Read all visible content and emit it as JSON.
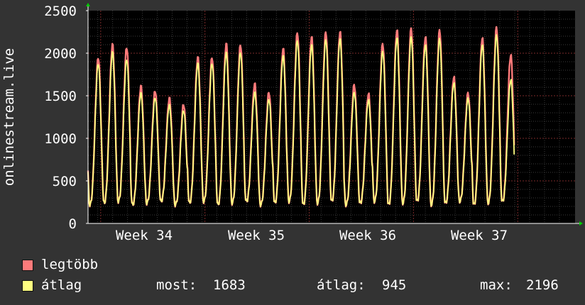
{
  "chart_data": {
    "type": "line",
    "ylabel": "onlinestream.live",
    "ylim": [
      0,
      2500
    ],
    "yticks": [
      "0",
      "500",
      "1000",
      "1500",
      "2000",
      "2500"
    ],
    "xticks": [
      "Week 34",
      "Week 35",
      "Week 36",
      "Week 37"
    ],
    "grid": true,
    "legend_position": "bottom-left",
    "days": 33,
    "series": [
      {
        "name": "legtöbb",
        "color": "#ff7b7b",
        "day_peaks": [
          1950,
          2100,
          2070,
          1610,
          1560,
          1470,
          1400,
          1950,
          1950,
          2110,
          2100,
          1640,
          1540,
          2050,
          2240,
          2190,
          2250,
          2250,
          1630,
          1520,
          2110,
          2270,
          2290,
          2190,
          2270,
          1720,
          1530,
          2180,
          2300,
          1980
        ]
      },
      {
        "name": "átlag",
        "color": "#ffff80",
        "day_peaks": [
          1880,
          2010,
          1930,
          1530,
          1480,
          1390,
          1330,
          1880,
          1880,
          2010,
          2010,
          1540,
          1460,
          1970,
          2150,
          2100,
          2160,
          2170,
          1540,
          1450,
          2020,
          2180,
          2190,
          2100,
          2170,
          1650,
          1470,
          2100,
          2210,
          1690
        ]
      }
    ],
    "stats": {
      "most_label": "most:",
      "most_value": "1683",
      "atlag_label": "átlag:",
      "atlag_value": "945",
      "max_label": "max:",
      "max_value": "2196"
    }
  }
}
